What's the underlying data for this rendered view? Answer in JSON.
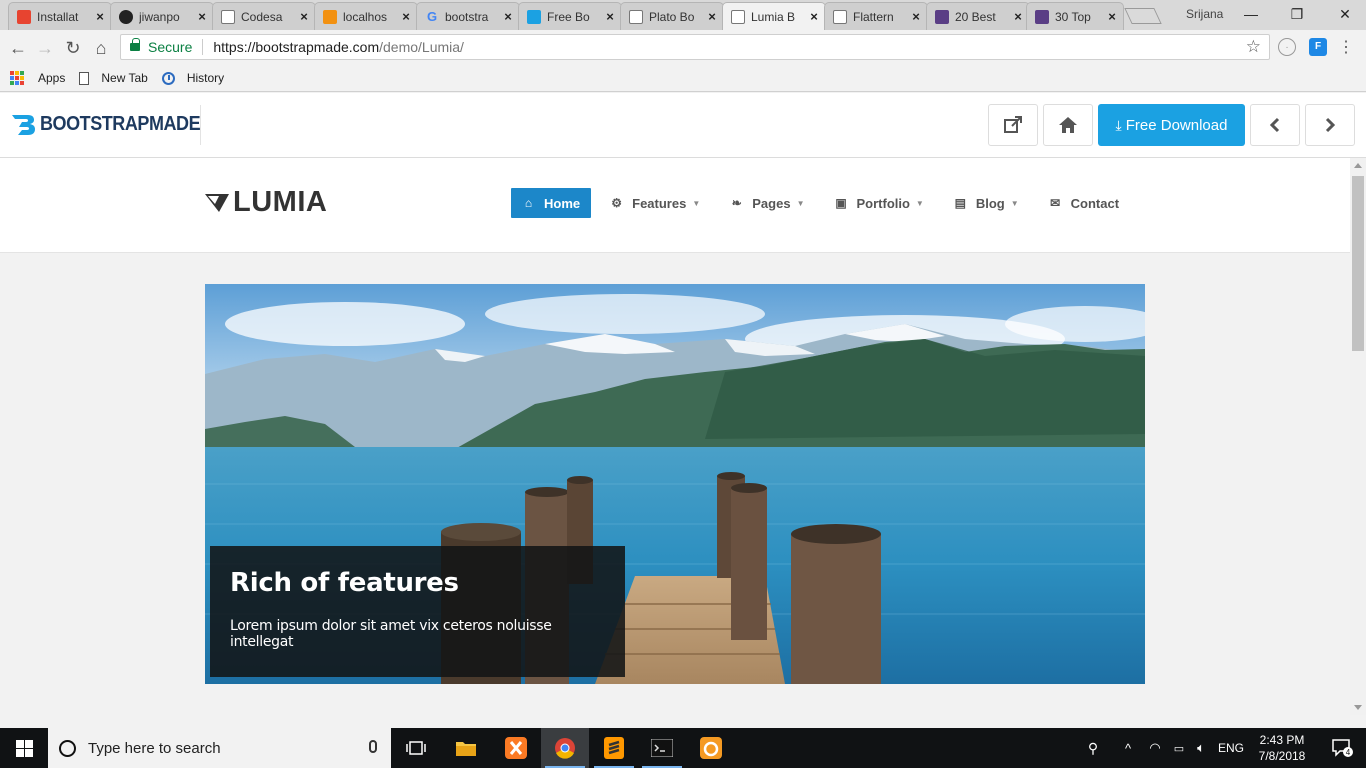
{
  "browser": {
    "tabs": [
      {
        "title": "Installat",
        "icon": "laravel-icon",
        "color": "#e74430"
      },
      {
        "title": "jiwanpo",
        "icon": "github-icon",
        "color": "#222222"
      },
      {
        "title": "Codesa",
        "icon": "page-icon",
        "color": "#777777"
      },
      {
        "title": "localhos",
        "icon": "phpmyadmin-icon",
        "color": "#f29111"
      },
      {
        "title": "bootstra",
        "icon": "google-icon",
        "color": "#4285f4"
      },
      {
        "title": "Free Bo",
        "icon": "bootstrapmade-icon",
        "color": "#1ba1e2"
      },
      {
        "title": "Plato Bo",
        "icon": "page-icon",
        "color": "#777777"
      },
      {
        "title": "Lumia B",
        "icon": "page-icon",
        "color": "#777777",
        "active": true
      },
      {
        "title": "Flattern",
        "icon": "page-icon",
        "color": "#777777"
      },
      {
        "title": "20 Best",
        "icon": "colorlib-icon",
        "color": "#5a3e85"
      },
      {
        "title": "30 Top",
        "icon": "colorlib-icon",
        "color": "#5a3e85"
      }
    ],
    "profile_name": "Srijana",
    "secure_label": "Secure",
    "url_host": "https://bootstrapmade.com",
    "url_path": "/demo/Lumia/",
    "bookmarks": {
      "apps": "Apps",
      "new_tab": "New Tab",
      "history": "History"
    }
  },
  "demobar": {
    "logo_text": "BOOTSTRAPMADE",
    "download_label": "Free Download",
    "accent": "#1ba1e2"
  },
  "site": {
    "logo_text": "LUMIA",
    "nav": [
      {
        "label": "Home",
        "icon": "home-icon",
        "active": true
      },
      {
        "label": "Features",
        "icon": "gear-icon",
        "dropdown": true
      },
      {
        "label": "Pages",
        "icon": "leaf-icon",
        "dropdown": true
      },
      {
        "label": "Portfolio",
        "icon": "briefcase-icon",
        "dropdown": true
      },
      {
        "label": "Blog",
        "icon": "book-icon",
        "dropdown": true
      },
      {
        "label": "Contact",
        "icon": "envelope-icon"
      }
    ],
    "slider": {
      "title": "Rich of features",
      "text": "Lorem ipsum dolor sit amet vix ceteros noluisse intellegat"
    },
    "nav_accent": "#1c87c9"
  },
  "taskbar": {
    "search_placeholder": "Type here to search",
    "language": "ENG",
    "time": "2:43 PM",
    "date": "7/8/2018",
    "notification_count": "4"
  }
}
